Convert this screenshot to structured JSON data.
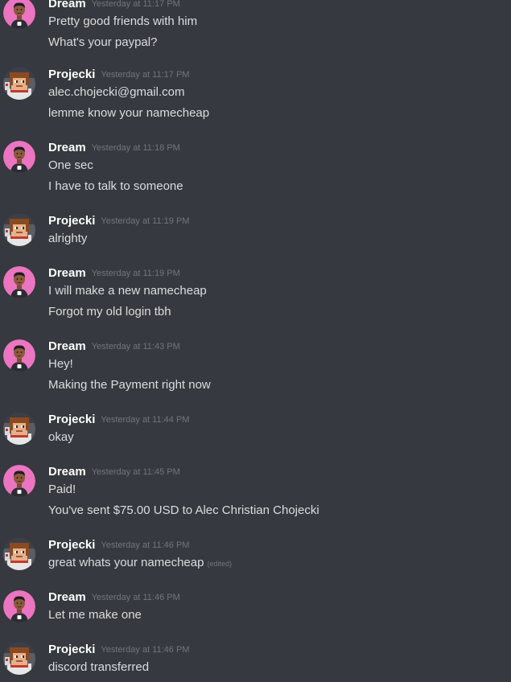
{
  "users": {
    "dream": "Dream",
    "projecki": "Projecki"
  },
  "colors": {
    "background": "#36393f",
    "username": "#ffffff",
    "message_text": "#dcddde",
    "timestamp": "#72767d",
    "dream_avatar_bg": "#eb75c0",
    "projecki_avatar_bg": "#5a5d66"
  },
  "icons": {
    "dream_avatar": "pink-circle-cartoon-avatar",
    "projecki_avatar": "pixel-art-character-avatar"
  },
  "groups": [
    {
      "author": "Dream",
      "avatar": "dream",
      "timestamp": "Yesterday at 11:17 PM",
      "lines": [
        "Pretty good friends with him",
        "What's your paypal?"
      ]
    },
    {
      "author": "Projecki",
      "avatar": "projecki",
      "timestamp": "Yesterday at 11:17 PM",
      "lines": [
        "alec.chojecki@gmail.com",
        "lemme know your namecheap"
      ]
    },
    {
      "author": "Dream",
      "avatar": "dream",
      "timestamp": "Yesterday at 11:18 PM",
      "lines": [
        "One sec",
        "I have to talk to someone"
      ]
    },
    {
      "author": "Projecki",
      "avatar": "projecki",
      "timestamp": "Yesterday at 11:19 PM",
      "lines": [
        "alrighty"
      ]
    },
    {
      "author": "Dream",
      "avatar": "dream",
      "timestamp": "Yesterday at 11:19 PM",
      "lines": [
        "I will make a new namecheap",
        "Forgot my old login tbh"
      ]
    },
    {
      "author": "Dream",
      "avatar": "dream",
      "timestamp": "Yesterday at 11:43 PM",
      "lines": [
        "Hey!",
        "Making the Payment right now"
      ]
    },
    {
      "author": "Projecki",
      "avatar": "projecki",
      "timestamp": "Yesterday at 11:44 PM",
      "lines": [
        "okay"
      ]
    },
    {
      "author": "Dream",
      "avatar": "dream",
      "timestamp": "Yesterday at 11:45 PM",
      "lines": [
        "Paid!",
        "You've sent $75.00 USD to Alec Christian Chojecki"
      ]
    },
    {
      "author": "Projecki",
      "avatar": "projecki",
      "timestamp": "Yesterday at 11:46 PM",
      "lines": [
        "great whats your namecheap"
      ],
      "edited": "(edited)"
    },
    {
      "author": "Dream",
      "avatar": "dream",
      "timestamp": "Yesterday at 11:46 PM",
      "lines": [
        "Let me make one"
      ]
    },
    {
      "author": "Projecki",
      "avatar": "projecki",
      "timestamp": "Yesterday at 11:46 PM",
      "lines": [
        "discord transferred"
      ]
    }
  ]
}
